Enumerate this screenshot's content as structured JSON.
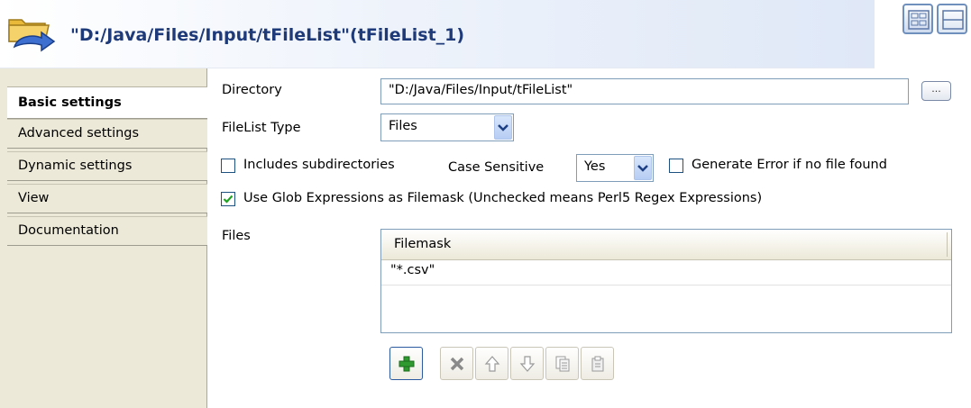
{
  "header": {
    "title": "\"D:/Java/Files/Input/tFileList\"(tFileList_1)",
    "icon": "folder-with-arrow-icon",
    "view_buttons": [
      "grid-view-icon",
      "split-view-icon"
    ]
  },
  "sidebar": {
    "tabs": [
      {
        "label": "Basic settings",
        "active": true
      },
      {
        "label": "Advanced settings",
        "active": false
      },
      {
        "label": "Dynamic settings",
        "active": false
      },
      {
        "label": "View",
        "active": false
      },
      {
        "label": "Documentation",
        "active": false
      }
    ]
  },
  "form": {
    "directory_label": "Directory",
    "directory_value": "\"D:/Java/Files/Input/tFileList\"",
    "browse_label": "...",
    "filelist_type_label": "FileList Type",
    "filelist_type_value": "Files",
    "includes_subdirectories_label": "Includes subdirectories",
    "includes_subdirectories_checked": false,
    "case_sensitive_label": "Case Sensitive",
    "case_sensitive_value": "Yes",
    "generate_error_label": "Generate Error if no file found",
    "generate_error_checked": false,
    "use_glob_label": "Use Glob Expressions as Filemask (Unchecked means Perl5 Regex Expressions)",
    "use_glob_checked": true,
    "files_label": "Files"
  },
  "files_table": {
    "columns": [
      "Filemask"
    ],
    "rows": [
      [
        "\"*.csv\""
      ]
    ]
  },
  "toolbar": {
    "buttons": [
      {
        "icon": "add-icon",
        "enabled": true
      },
      {
        "icon": "delete-icon",
        "enabled": false
      },
      {
        "icon": "move-up-icon",
        "enabled": false
      },
      {
        "icon": "move-down-icon",
        "enabled": false
      },
      {
        "icon": "copy-icon",
        "enabled": false
      },
      {
        "icon": "paste-icon",
        "enabled": false
      }
    ]
  },
  "colors": {
    "title": "#1e3a78",
    "sidebar_bg": "#ece9d8",
    "add_green": "#2f9a2f",
    "checkmark": "#21a121"
  }
}
